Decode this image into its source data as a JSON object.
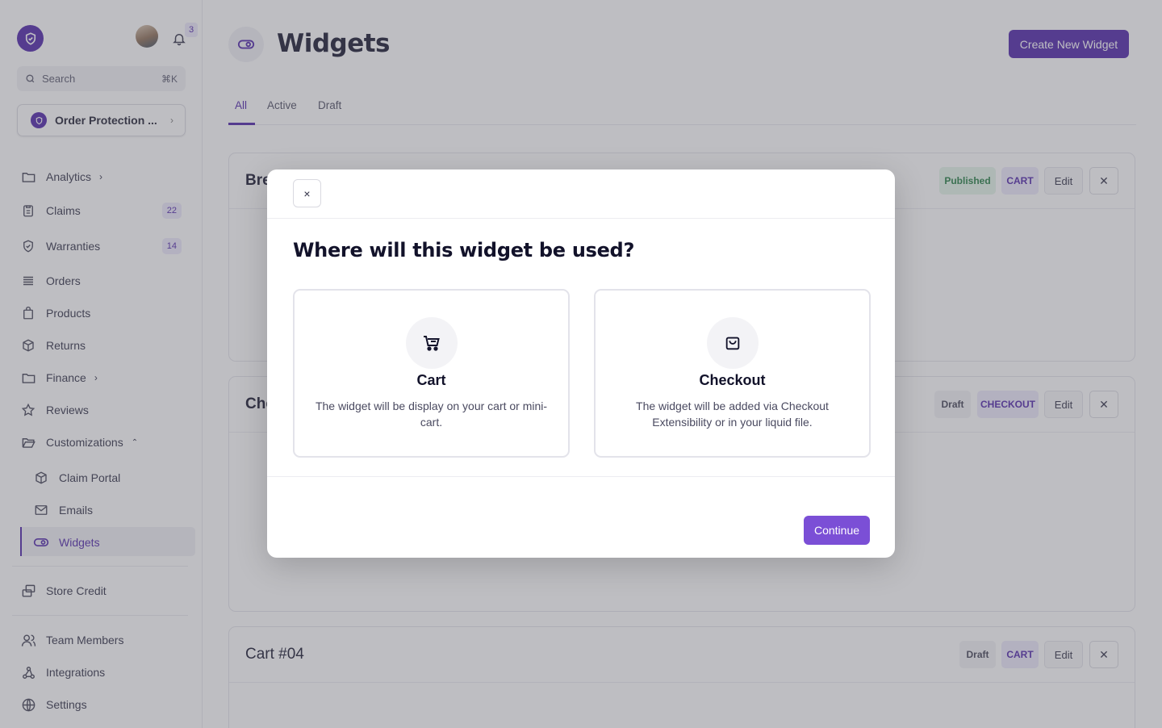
{
  "sidebar": {
    "notifications_count": "3",
    "search": {
      "placeholder": "Search",
      "shortcut": "⌘K"
    },
    "store_selector": {
      "label": "Order Protection ..."
    },
    "items": [
      {
        "label": "Analytics",
        "icon": "folder-icon"
      },
      {
        "label": "Claims",
        "icon": "clipboard-icon",
        "badge": "22"
      },
      {
        "label": "Warranties",
        "icon": "shield-icon",
        "badge": "14"
      },
      {
        "label": "Orders",
        "icon": "list-icon"
      },
      {
        "label": "Products",
        "icon": "bag-icon"
      },
      {
        "label": "Returns",
        "icon": "box-icon"
      },
      {
        "label": "Finance",
        "icon": "folder-icon"
      },
      {
        "label": "Reviews",
        "icon": "star-icon"
      },
      {
        "label": "Customizations",
        "icon": "folder-open-icon"
      }
    ],
    "sub_items": [
      {
        "label": "Claim Portal",
        "icon": "box-icon"
      },
      {
        "label": "Emails",
        "icon": "mail-icon"
      },
      {
        "label": "Widgets",
        "icon": "toggle-icon"
      }
    ],
    "bottom_items": [
      {
        "label": "Store Credit",
        "icon": "credit-icon"
      },
      {
        "label": "Team Members",
        "icon": "users-icon"
      },
      {
        "label": "Integrations",
        "icon": "webhook-icon"
      },
      {
        "label": "Settings",
        "icon": "globe-icon"
      }
    ]
  },
  "header": {
    "title": "Widgets",
    "create_button": "Create New Widget"
  },
  "tabs": [
    "All",
    "Active",
    "Draft"
  ],
  "cards": [
    {
      "title": "Bre",
      "status": "Published",
      "type": "CART",
      "edit": "Edit"
    },
    {
      "title": "Che",
      "status": "Draft",
      "type": "CHECKOUT",
      "edit": "Edit"
    },
    {
      "title": "Cart #04",
      "status": "Draft",
      "type": "CART",
      "edit": "Edit"
    }
  ],
  "modal": {
    "close": "×",
    "title": "Where will this widget be used?",
    "options": [
      {
        "title": "Cart",
        "description": "The widget will be display on your cart or mini-cart.",
        "icon": "cart-icon"
      },
      {
        "title": "Checkout",
        "description": "The widget will be added via Checkout Extensibility or in your liquid file.",
        "icon": "bag-icon"
      }
    ],
    "continue_button": "Continue"
  },
  "colors": {
    "brand": "#4a1fa8",
    "continue": "#7b4fd6",
    "published_bg": "#e3f4e8"
  }
}
